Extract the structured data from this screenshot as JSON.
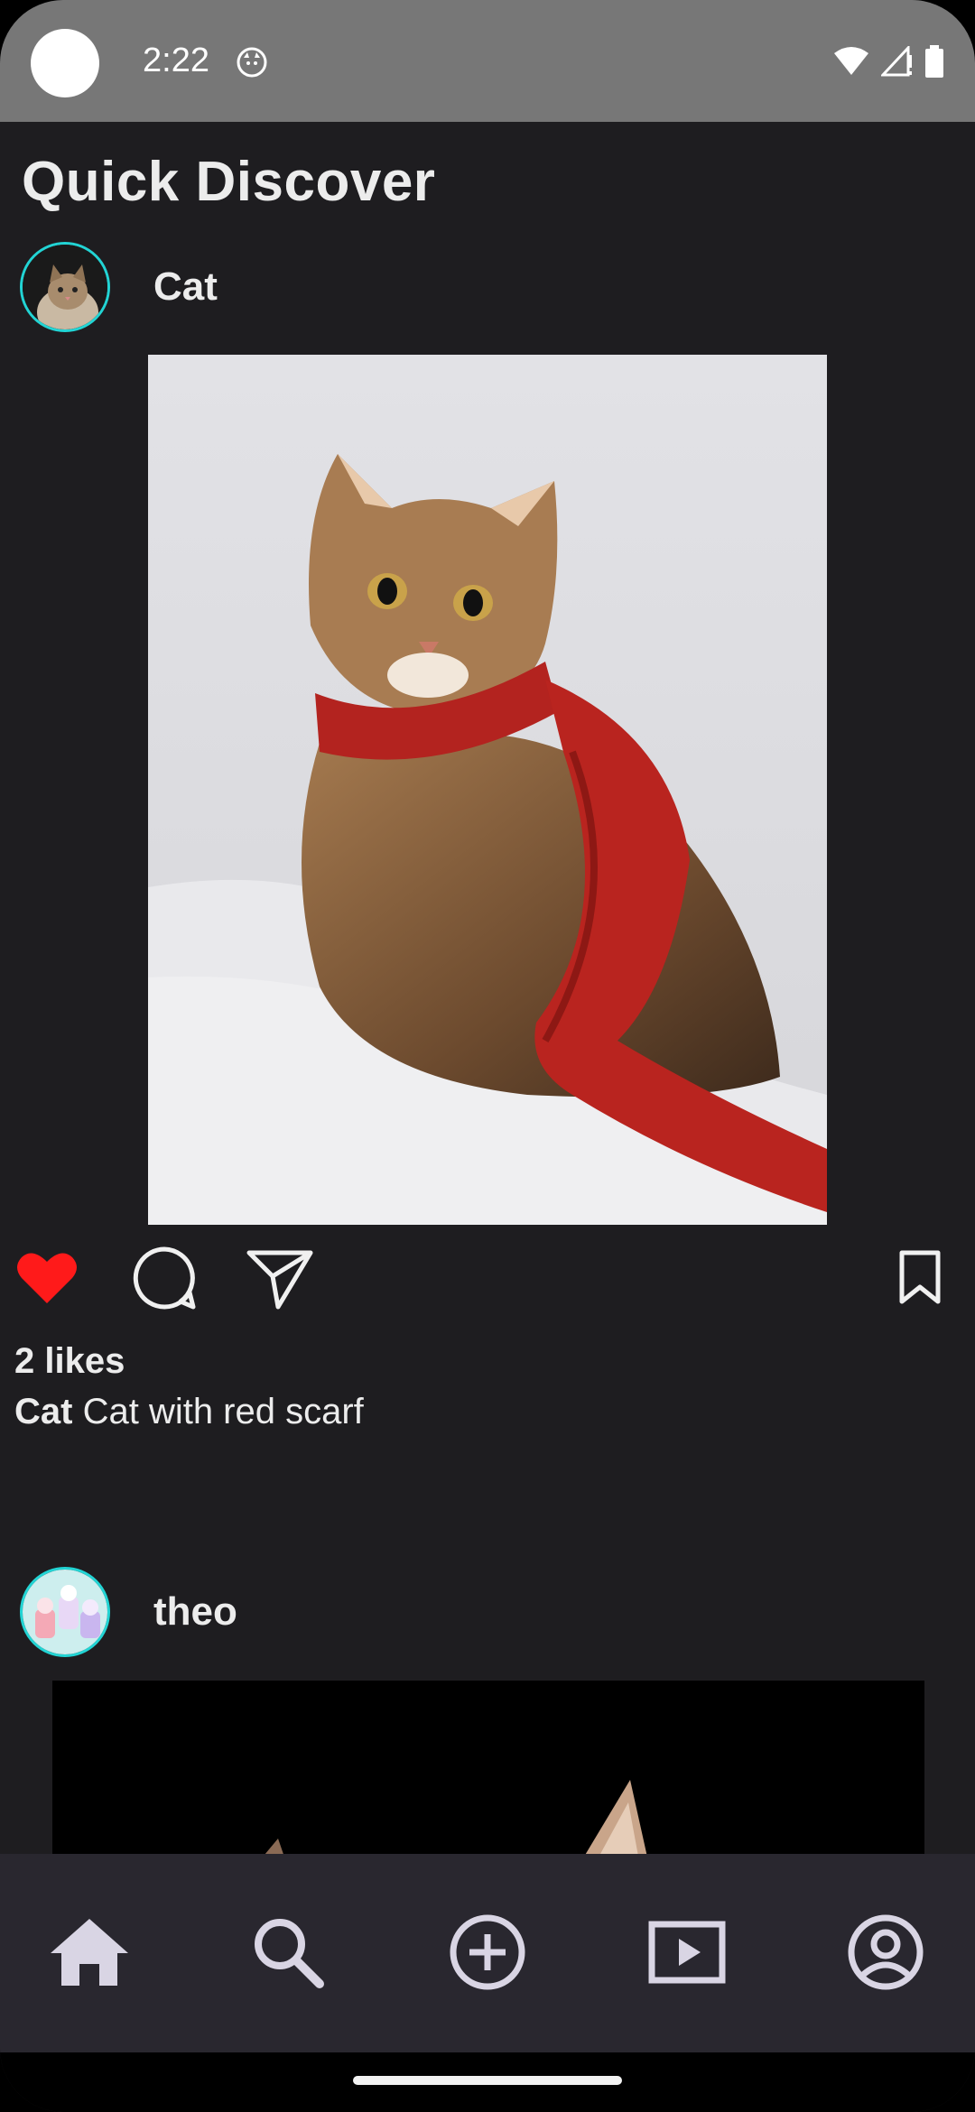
{
  "status_bar": {
    "time": "2:22",
    "icons": [
      "wifi-icon",
      "signal-icon",
      "battery-icon"
    ]
  },
  "app": {
    "title": "Quick Discover"
  },
  "posts": [
    {
      "username": "Cat",
      "likes": "2 likes",
      "caption_user": "Cat",
      "caption_text": "Cat with red scarf",
      "liked": true,
      "image_desc": "tabby cat wearing red knitted scarf"
    },
    {
      "username": "theo"
    }
  ],
  "nav": {
    "items": [
      "home-icon",
      "search-icon",
      "add-icon",
      "video-icon",
      "profile-icon"
    ]
  },
  "colors": {
    "background": "#1e1d20",
    "status_bar": "#777777",
    "nav_bar": "#29272f",
    "like_red": "#ff1a1a",
    "avatar_ring": "#22d4d4",
    "nav_icon": "#d9d5e4"
  }
}
